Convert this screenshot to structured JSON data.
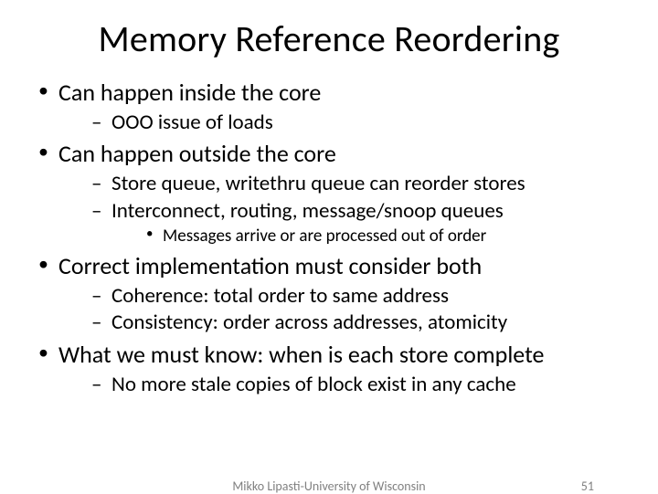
{
  "title": "Memory Reference Reordering",
  "bullets": {
    "b1": "Can happen inside the core",
    "b1a": "OOO issue of loads",
    "b2": "Can happen outside the core",
    "b2a": "Store queue, writethru queue can reorder stores",
    "b2b": "Interconnect, routing, message/snoop queues",
    "b2b1": "Messages arrive or are processed out of order",
    "b3": "Correct implementation must consider both",
    "b3a": "Coherence: total order to same address",
    "b3b": "Consistency: order across addresses, atomicity",
    "b4": "What we must know: when is each store complete",
    "b4a": "No more stale copies of block exist in any cache"
  },
  "footer": {
    "author": "Mikko Lipasti-University of Wisconsin",
    "page": "51"
  }
}
